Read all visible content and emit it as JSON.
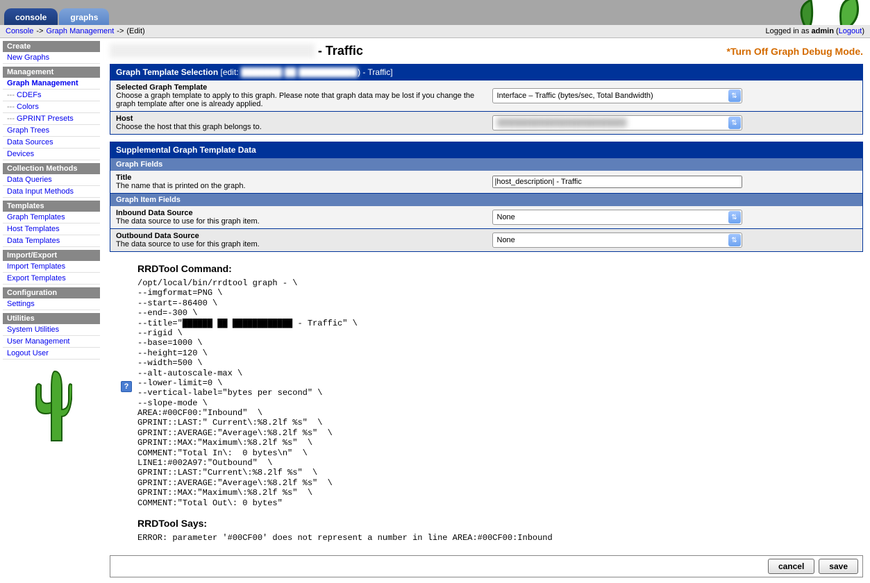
{
  "tabs": {
    "console": "console",
    "graphs": "graphs"
  },
  "breadcrumb": {
    "console": "Console",
    "graph_mgmt": "Graph Management",
    "edit": "(Edit)"
  },
  "login": {
    "prefix": "Logged in as ",
    "user": "admin",
    "logout": "Logout"
  },
  "page_title": {
    "blurred": "████████ (██ ███████ ████)",
    "suffix": " - Traffic"
  },
  "debug_link": "Turn Off Graph Debug Mode.",
  "sidebar": {
    "create": "Create",
    "new_graphs": "New Graphs",
    "management": "Management",
    "graph_management": "Graph Management",
    "cdefs": "CDEFs",
    "colors": "Colors",
    "gprint": "GPRINT Presets",
    "graph_trees": "Graph Trees",
    "data_sources": "Data Sources",
    "devices": "Devices",
    "collection_methods": "Collection Methods",
    "data_queries": "Data Queries",
    "data_input": "Data Input Methods",
    "templates": "Templates",
    "graph_templates": "Graph Templates",
    "host_templates": "Host Templates",
    "data_templates": "Data Templates",
    "import_export": "Import/Export",
    "import_templates": "Import Templates",
    "export_templates": "Export Templates",
    "configuration": "Configuration",
    "settings": "Settings",
    "utilities": "Utilities",
    "system_utilities": "System Utilities",
    "user_management": "User Management",
    "logout_user": "Logout User"
  },
  "section1": {
    "header": "Graph Template Selection",
    "edit_label": "[edit: ",
    "edit_blur": "███████ ██ ██████████",
    "edit_suffix": ") - Traffic]",
    "row1_label": "Selected Graph Template",
    "row1_desc": "Choose a graph template to apply to this graph. Please note that graph data may be lost if you change the graph template after one is already applied.",
    "row1_value": "Interface – Traffic (bytes/sec, Total Bandwidth)",
    "row2_label": "Host",
    "row2_desc": "Choose the host that this graph belongs to.",
    "row2_value": "████████████████████████"
  },
  "section2": {
    "header": "Supplemental Graph Template Data",
    "sub1": "Graph Fields",
    "title_label": "Title",
    "title_desc": "The name that is printed on the graph.",
    "title_value": "|host_description| - Traffic",
    "sub2": "Graph Item Fields",
    "inbound_label": "Inbound Data Source",
    "inbound_desc": "The data source to use for this graph item.",
    "inbound_value": "None",
    "outbound_label": "Outbound Data Source",
    "outbound_desc": "The data source to use for this graph item.",
    "outbound_value": "None"
  },
  "rrd": {
    "cmd_header": "RRDTool Command:",
    "cmd_lines": "/opt/local/bin/rrdtool graph - \\\n--imgformat=PNG \\\n--start=-86400 \\\n--end=-300 \\\n--title=\"██████ ██ ████████████ - Traffic\" \\\n--rigid \\\n--base=1000 \\\n--height=120 \\\n--width=500 \\\n--alt-autoscale-max \\\n--lower-limit=0 \\\n--vertical-label=\"bytes per second\" \\\n--slope-mode \\\nAREA:#00CF00:\"Inbound\"  \\\nGPRINT::LAST:\" Current\\:%8.2lf %s\"  \\\nGPRINT::AVERAGE:\"Average\\:%8.2lf %s\"  \\\nGPRINT::MAX:\"Maximum\\:%8.2lf %s\"  \\\nCOMMENT:\"Total In\\:  0 bytes\\n\"  \\\nLINE1:#002A97:\"Outbound\"  \\\nGPRINT::LAST:\"Current\\:%8.2lf %s\"  \\\nGPRINT::AVERAGE:\"Average\\:%8.2lf %s\"  \\\nGPRINT::MAX:\"Maximum\\:%8.2lf %s\"  \\\nCOMMENT:\"Total Out\\: 0 bytes\"",
    "says_header": "RRDTool Says:",
    "error": "ERROR: parameter '#00CF00' does not represent a number in line AREA:#00CF00:Inbound"
  },
  "buttons": {
    "cancel": "cancel",
    "save": "save"
  }
}
